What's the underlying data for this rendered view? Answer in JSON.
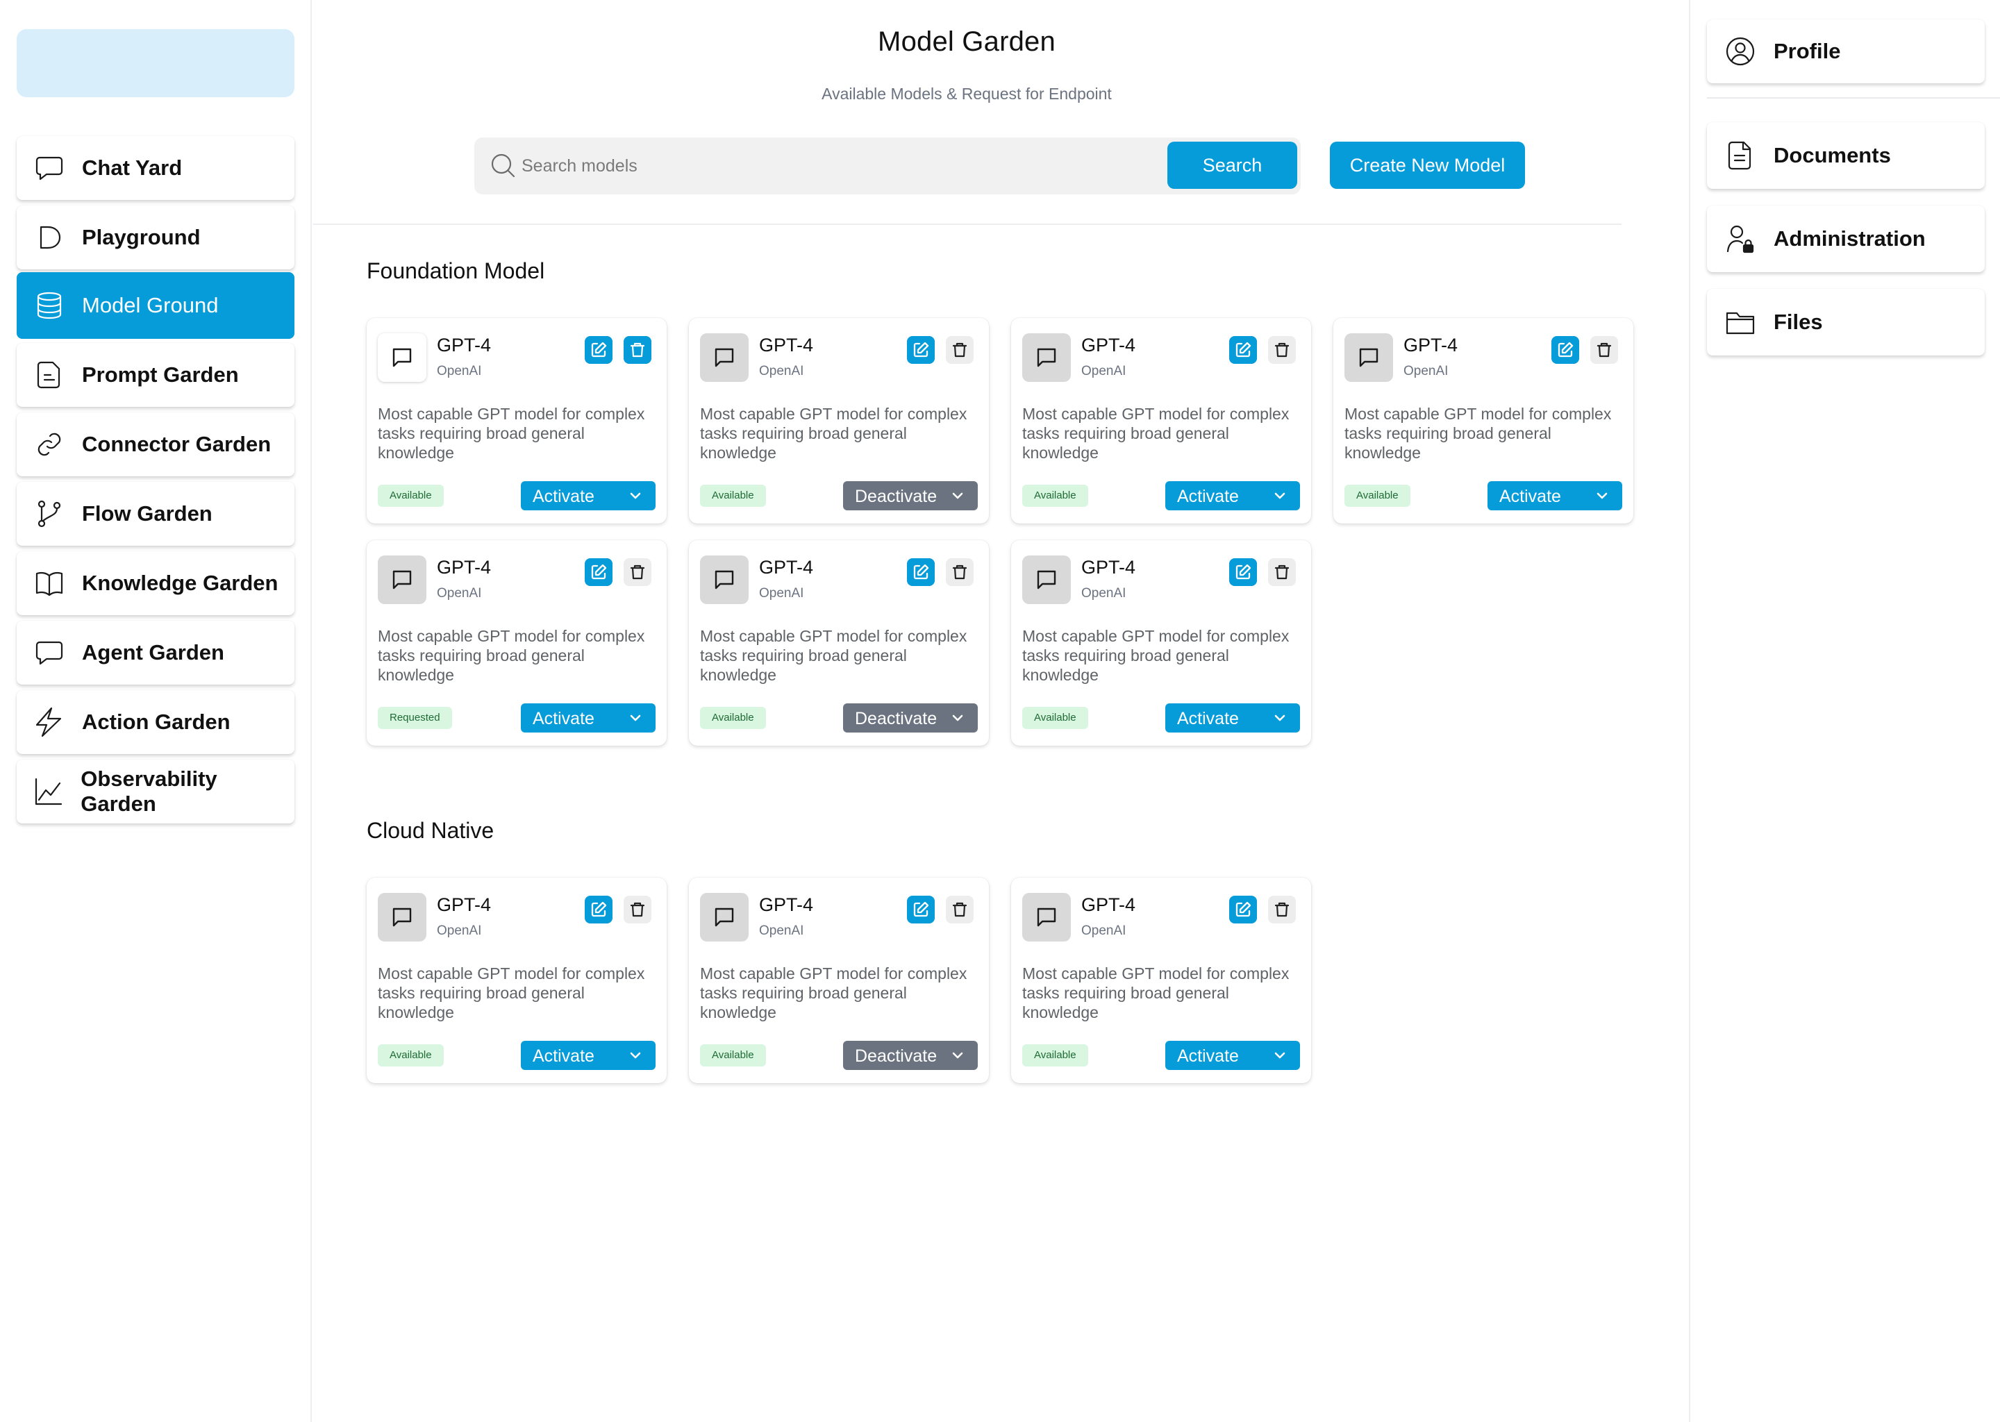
{
  "header": {
    "title": "Model Garden",
    "subtitle": "Available Models & Request for Endpoint"
  },
  "search": {
    "placeholder": "Search models",
    "value": "",
    "button_label": "Search"
  },
  "toolbar": {
    "create_label": "Create New Model"
  },
  "left_nav": {
    "items": [
      {
        "label": "Chat Yard",
        "icon": "chat-bubble-icon"
      },
      {
        "label": "Playground",
        "icon": "play-icon"
      },
      {
        "label": "Model Ground",
        "icon": "database-icon",
        "active": true
      },
      {
        "label": "Prompt Garden",
        "icon": "document-text-icon"
      },
      {
        "label": "Connector Garden",
        "icon": "link-icon"
      },
      {
        "label": "Flow Garden",
        "icon": "git-branch-icon"
      },
      {
        "label": "Knowledge Garden",
        "icon": "book-icon"
      },
      {
        "label": "Agent Garden",
        "icon": "chat-bubble-icon"
      },
      {
        "label": "Action Garden",
        "icon": "bolt-icon"
      },
      {
        "label": "Observability Garden",
        "icon": "line-chart-icon"
      }
    ]
  },
  "right_nav": {
    "items": [
      {
        "label": "Profile",
        "icon": "user-circle-icon"
      },
      {
        "label": "Documents",
        "icon": "document-icon"
      },
      {
        "label": "Administration",
        "icon": "user-lock-icon"
      },
      {
        "label": "Files",
        "icon": "folder-icon"
      }
    ]
  },
  "sections": [
    {
      "title": "Foundation Model",
      "cards": [
        {
          "name": "GPT-4",
          "provider": "OpenAI",
          "description": "Most capable GPT model for complex tasks requiring broad general knowledge",
          "status": "Available",
          "action": "Activate"
        },
        {
          "name": "GPT-4",
          "provider": "OpenAI",
          "description": "Most capable GPT model for complex tasks requiring broad general knowledge",
          "status": "Available",
          "action": "Deactivate"
        },
        {
          "name": "GPT-4",
          "provider": "OpenAI",
          "description": "Most capable GPT model for complex tasks requiring broad general knowledge",
          "status": "Available",
          "action": "Activate"
        },
        {
          "name": "GPT-4",
          "provider": "OpenAI",
          "description": "Most capable GPT model for complex tasks requiring broad general knowledge",
          "status": "Available",
          "action": "Activate"
        },
        {
          "name": "GPT-4",
          "provider": "OpenAI",
          "description": "Most capable GPT model for complex tasks requiring broad general knowledge",
          "status": "Requested",
          "action": "Activate"
        },
        {
          "name": "GPT-4",
          "provider": "OpenAI",
          "description": "Most capable GPT model for complex tasks requiring broad general knowledge",
          "status": "Available",
          "action": "Deactivate"
        },
        {
          "name": "GPT-4",
          "provider": "OpenAI",
          "description": "Most capable GPT model for complex tasks requiring broad general knowledge",
          "status": "Available",
          "action": "Activate"
        }
      ]
    },
    {
      "title": "Cloud Native",
      "cards": [
        {
          "name": "GPT-4",
          "provider": "OpenAI",
          "description": "Most capable GPT model for complex tasks requiring broad general knowledge",
          "status": "Available",
          "action": "Activate"
        },
        {
          "name": "GPT-4",
          "provider": "OpenAI",
          "description": "Most capable GPT model for complex tasks requiring broad general knowledge",
          "status": "Available",
          "action": "Deactivate"
        },
        {
          "name": "GPT-4",
          "provider": "OpenAI",
          "description": "Most capable GPT model for complex tasks requiring broad general knowledge",
          "status": "Available",
          "action": "Activate"
        }
      ]
    }
  ],
  "colors": {
    "accent": "#069bd9",
    "deactivate": "#6b7380",
    "status_bg": "#d9f6e0",
    "logo_placeholder": "#d9eefb"
  }
}
